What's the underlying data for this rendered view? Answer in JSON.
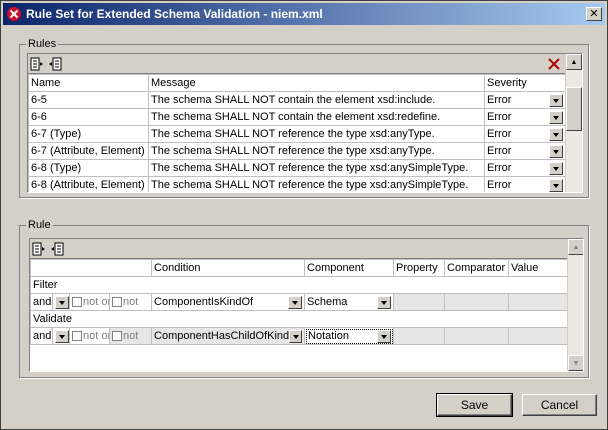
{
  "window": {
    "title": "Rule Set for Extended Schema Validation - niem.xml"
  },
  "rules": {
    "group_label": "Rules",
    "columns": [
      "Name",
      "Message",
      "Severity"
    ],
    "rows": [
      {
        "name": "6-5",
        "message": "The schema SHALL NOT contain the element xsd:include.",
        "severity": "Error"
      },
      {
        "name": "6-6",
        "message": "The schema SHALL NOT contain the element xsd:redefine.",
        "severity": "Error"
      },
      {
        "name": "6-7 (Type)",
        "message": "The schema SHALL NOT reference the type xsd:anyType.",
        "severity": "Error"
      },
      {
        "name": "6-7 (Attribute, Element)",
        "message": "The schema SHALL NOT reference the type xsd:anyType.",
        "severity": "Error"
      },
      {
        "name": "6-8 (Type)",
        "message": "The schema SHALL NOT reference the type xsd:anySimpleType.",
        "severity": "Error"
      },
      {
        "name": "6-8 (Attribute, Element)",
        "message": "The schema SHALL NOT reference the type xsd:anySimpleType.",
        "severity": "Error"
      }
    ]
  },
  "rule": {
    "group_label": "Rule",
    "columns": [
      "Condition",
      "Component",
      "Property",
      "Comparator",
      "Value"
    ],
    "filter_label": "Filter",
    "validate_label": "Validate",
    "filter_row": {
      "op": "and",
      "not_or": "not or",
      "not": "not",
      "condition": "ComponentIsKindOf",
      "component": "Schema"
    },
    "validate_row": {
      "op": "and",
      "not_or": "not or",
      "not": "not",
      "condition": "ComponentHasChildOfKind",
      "component": "Notation"
    }
  },
  "buttons": {
    "save": "Save",
    "cancel": "Cancel"
  }
}
